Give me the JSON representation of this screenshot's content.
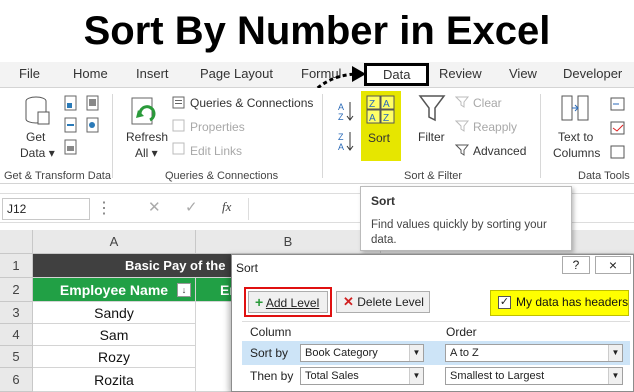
{
  "title": "Sort By Number in Excel",
  "tabs": [
    "File",
    "Home",
    "Insert",
    "Page Layout",
    "Formulas",
    "Data",
    "Review",
    "View",
    "Developer"
  ],
  "active_tab": "Data",
  "ribbon": {
    "get_data": [
      "Get",
      "Data"
    ],
    "refresh": [
      "Refresh",
      "All"
    ],
    "queries_connections": "Queries & Connections",
    "properties": "Properties",
    "edit_links": "Edit Links",
    "sort": "Sort",
    "filter": "Filter",
    "clear": "Clear",
    "reapply": "Reapply",
    "advanced": "Advanced",
    "text_to_columns": [
      "Text to",
      "Columns"
    ],
    "groups": {
      "get_transform": "Get & Transform Data",
      "queries": "Queries & Connections",
      "sort_filter": "Sort & Filter",
      "data_tools": "Data Tools"
    }
  },
  "formula_bar": {
    "name_box": "J12",
    "fx": "fx"
  },
  "tooltip": {
    "title": "Sort",
    "text": [
      "Find values quickly by sorting your",
      "data."
    ]
  },
  "sheet": {
    "columns": [
      "A",
      "B"
    ],
    "rows": [
      "1",
      "2",
      "3",
      "4",
      "5",
      "6"
    ],
    "row1_header": "Basic Pay of the",
    "table_header": "Employee Name",
    "b2_partial": "En",
    "names": [
      "Sandy",
      "Sam",
      "Rozy",
      "Rozita"
    ]
  },
  "dialog": {
    "title": "Sort",
    "help": "?",
    "close": "×",
    "add_level": "Add Level",
    "delete_level": "Delete Level",
    "headers_checkbox": "My data has headers",
    "col_header": "Column",
    "order_header": "Order",
    "sort_by": "Sort by",
    "then_by": "Then by",
    "sort_by_value": "Book Category",
    "then_by_value": "Total Sales",
    "order1": "A to Z",
    "order2": "Smallest to Largest"
  },
  "colors": {
    "green_header": "#21a045",
    "row1_fill": "#404040",
    "highlight_yellow": "#ffff00",
    "red_box": "#e01010"
  }
}
